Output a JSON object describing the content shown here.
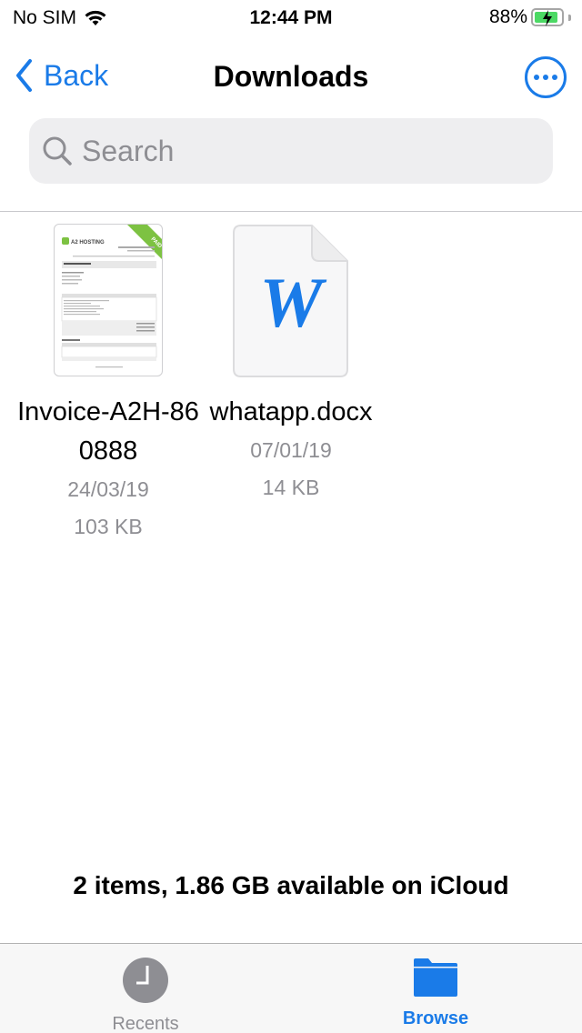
{
  "status_bar": {
    "carrier": "No SIM",
    "time": "12:44 PM",
    "battery_percent": "88%",
    "battery_level": 0.88,
    "charging": true
  },
  "nav": {
    "back_label": "Back",
    "title": "Downloads"
  },
  "search": {
    "placeholder": "Search"
  },
  "files": [
    {
      "name": "Invoice-A2H-860888",
      "date": "24/03/19",
      "size": "103 KB",
      "type": "pdf-invoice",
      "thumbnail_badge": "PAID",
      "thumbnail_brand": "A2 HOSTING"
    },
    {
      "name": "whatapp.docx",
      "date": "07/01/19",
      "size": "14 KB",
      "type": "word-document",
      "icon_letter": "W"
    }
  ],
  "footer": {
    "summary": "2 items, 1.86 GB available on iCloud"
  },
  "tab_bar": {
    "tabs": [
      {
        "label": "Recents",
        "icon": "clock-icon",
        "active": false
      },
      {
        "label": "Browse",
        "icon": "folder-icon",
        "active": true
      }
    ]
  },
  "colors": {
    "accent": "#1a7be8",
    "secondary_text": "#8e8e93",
    "search_bg": "#eeeef0",
    "battery_green": "#4cd964",
    "paid_ribbon": "#7dc242"
  }
}
